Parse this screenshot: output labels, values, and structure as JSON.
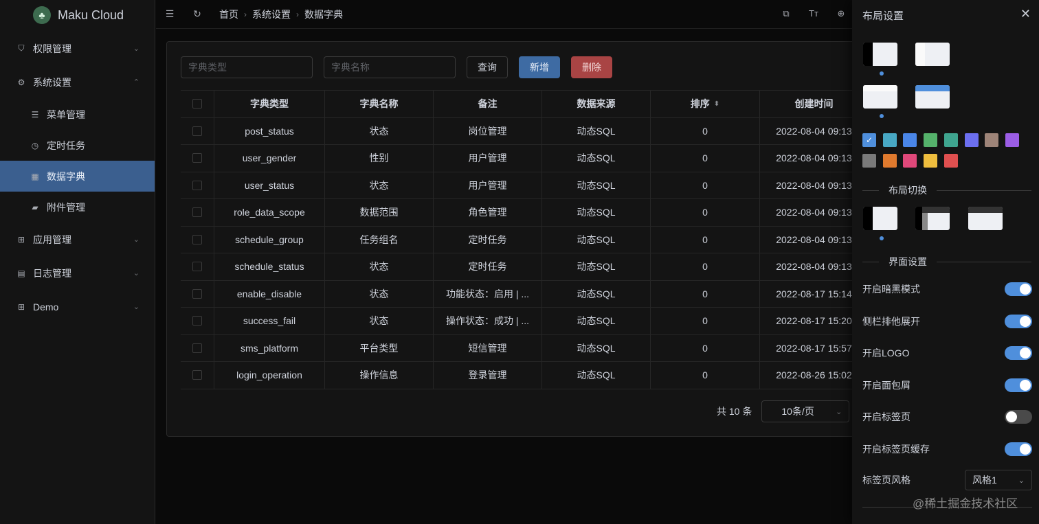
{
  "app": {
    "logo_text": "Maku Cloud"
  },
  "sidebar": {
    "items": [
      {
        "label": "权限管理",
        "icon": "shield-icon"
      },
      {
        "label": "系统设置",
        "icon": "gear-icon"
      },
      {
        "label": "菜单管理",
        "icon": "menu-icon"
      },
      {
        "label": "定时任务",
        "icon": "clock-icon"
      },
      {
        "label": "数据字典",
        "icon": "table-icon"
      },
      {
        "label": "附件管理",
        "icon": "folder-icon"
      },
      {
        "label": "应用管理",
        "icon": "grid-icon"
      },
      {
        "label": "日志管理",
        "icon": "document-icon"
      },
      {
        "label": "Demo",
        "icon": "grid-icon"
      }
    ]
  },
  "header": {
    "breadcrumb": [
      "首页",
      "系统设置",
      "数据字典"
    ]
  },
  "toolbar": {
    "dict_type_placeholder": "字典类型",
    "dict_name_placeholder": "字典名称",
    "query_label": "查询",
    "add_label": "新增",
    "delete_label": "删除"
  },
  "table": {
    "columns": [
      "字典类型",
      "字典名称",
      "备注",
      "数据来源",
      "排序",
      "创建时间"
    ],
    "rows": [
      {
        "type": "post_status",
        "name": "状态",
        "remark": "岗位管理",
        "source": "动态SQL",
        "sort": "0",
        "created": "2022-08-04 09:13"
      },
      {
        "type": "user_gender",
        "name": "性别",
        "remark": "用户管理",
        "source": "动态SQL",
        "sort": "0",
        "created": "2022-08-04 09:13"
      },
      {
        "type": "user_status",
        "name": "状态",
        "remark": "用户管理",
        "source": "动态SQL",
        "sort": "0",
        "created": "2022-08-04 09:13"
      },
      {
        "type": "role_data_scope",
        "name": "数据范围",
        "remark": "角色管理",
        "source": "动态SQL",
        "sort": "0",
        "created": "2022-08-04 09:13"
      },
      {
        "type": "schedule_group",
        "name": "任务组名",
        "remark": "定时任务",
        "source": "动态SQL",
        "sort": "0",
        "created": "2022-08-04 09:13"
      },
      {
        "type": "schedule_status",
        "name": "状态",
        "remark": "定时任务",
        "source": "动态SQL",
        "sort": "0",
        "created": "2022-08-04 09:13"
      },
      {
        "type": "enable_disable",
        "name": "状态",
        "remark": "功能状态：启用 | ...",
        "source": "动态SQL",
        "sort": "0",
        "created": "2022-08-17 15:14"
      },
      {
        "type": "success_fail",
        "name": "状态",
        "remark": "操作状态：成功 | ...",
        "source": "动态SQL",
        "sort": "0",
        "created": "2022-08-17 15:20"
      },
      {
        "type": "sms_platform",
        "name": "平台类型",
        "remark": "短信管理",
        "source": "动态SQL",
        "sort": "0",
        "created": "2022-08-17 15:57"
      },
      {
        "type": "login_operation",
        "name": "操作信息",
        "remark": "登录管理",
        "source": "动态SQL",
        "sort": "0",
        "created": "2022-08-26 15:02"
      }
    ]
  },
  "pagination": {
    "total": "共 10 条",
    "page_size": "10条/页"
  },
  "drawer": {
    "title": "布局设置",
    "theme_colors": [
      "#4f8fdc",
      "#48a8c4",
      "#4a86e8",
      "#55b26b",
      "#3fa58f",
      "#6c6ff0",
      "#9e8478",
      "#9b5de5",
      "#7a7a7a",
      "#e07a2e",
      "#e0487a",
      "#efbe3e",
      "#e05050"
    ],
    "selected_color_index": 0,
    "layout_switch_label": "布局切换",
    "ui_settings_label": "界面设置",
    "settings": [
      {
        "label": "开启暗黑模式",
        "on": true
      },
      {
        "label": "侧栏排他展开",
        "on": true
      },
      {
        "label": "开启LOGO",
        "on": true
      },
      {
        "label": "开启面包屑",
        "on": true
      },
      {
        "label": "开启标签页",
        "on": false
      },
      {
        "label": "开启标签页缓存",
        "on": true
      }
    ],
    "tab_style_label": "标签页风格",
    "tab_style_value": "风格1"
  },
  "watermark": "@稀土掘金技术社区"
}
